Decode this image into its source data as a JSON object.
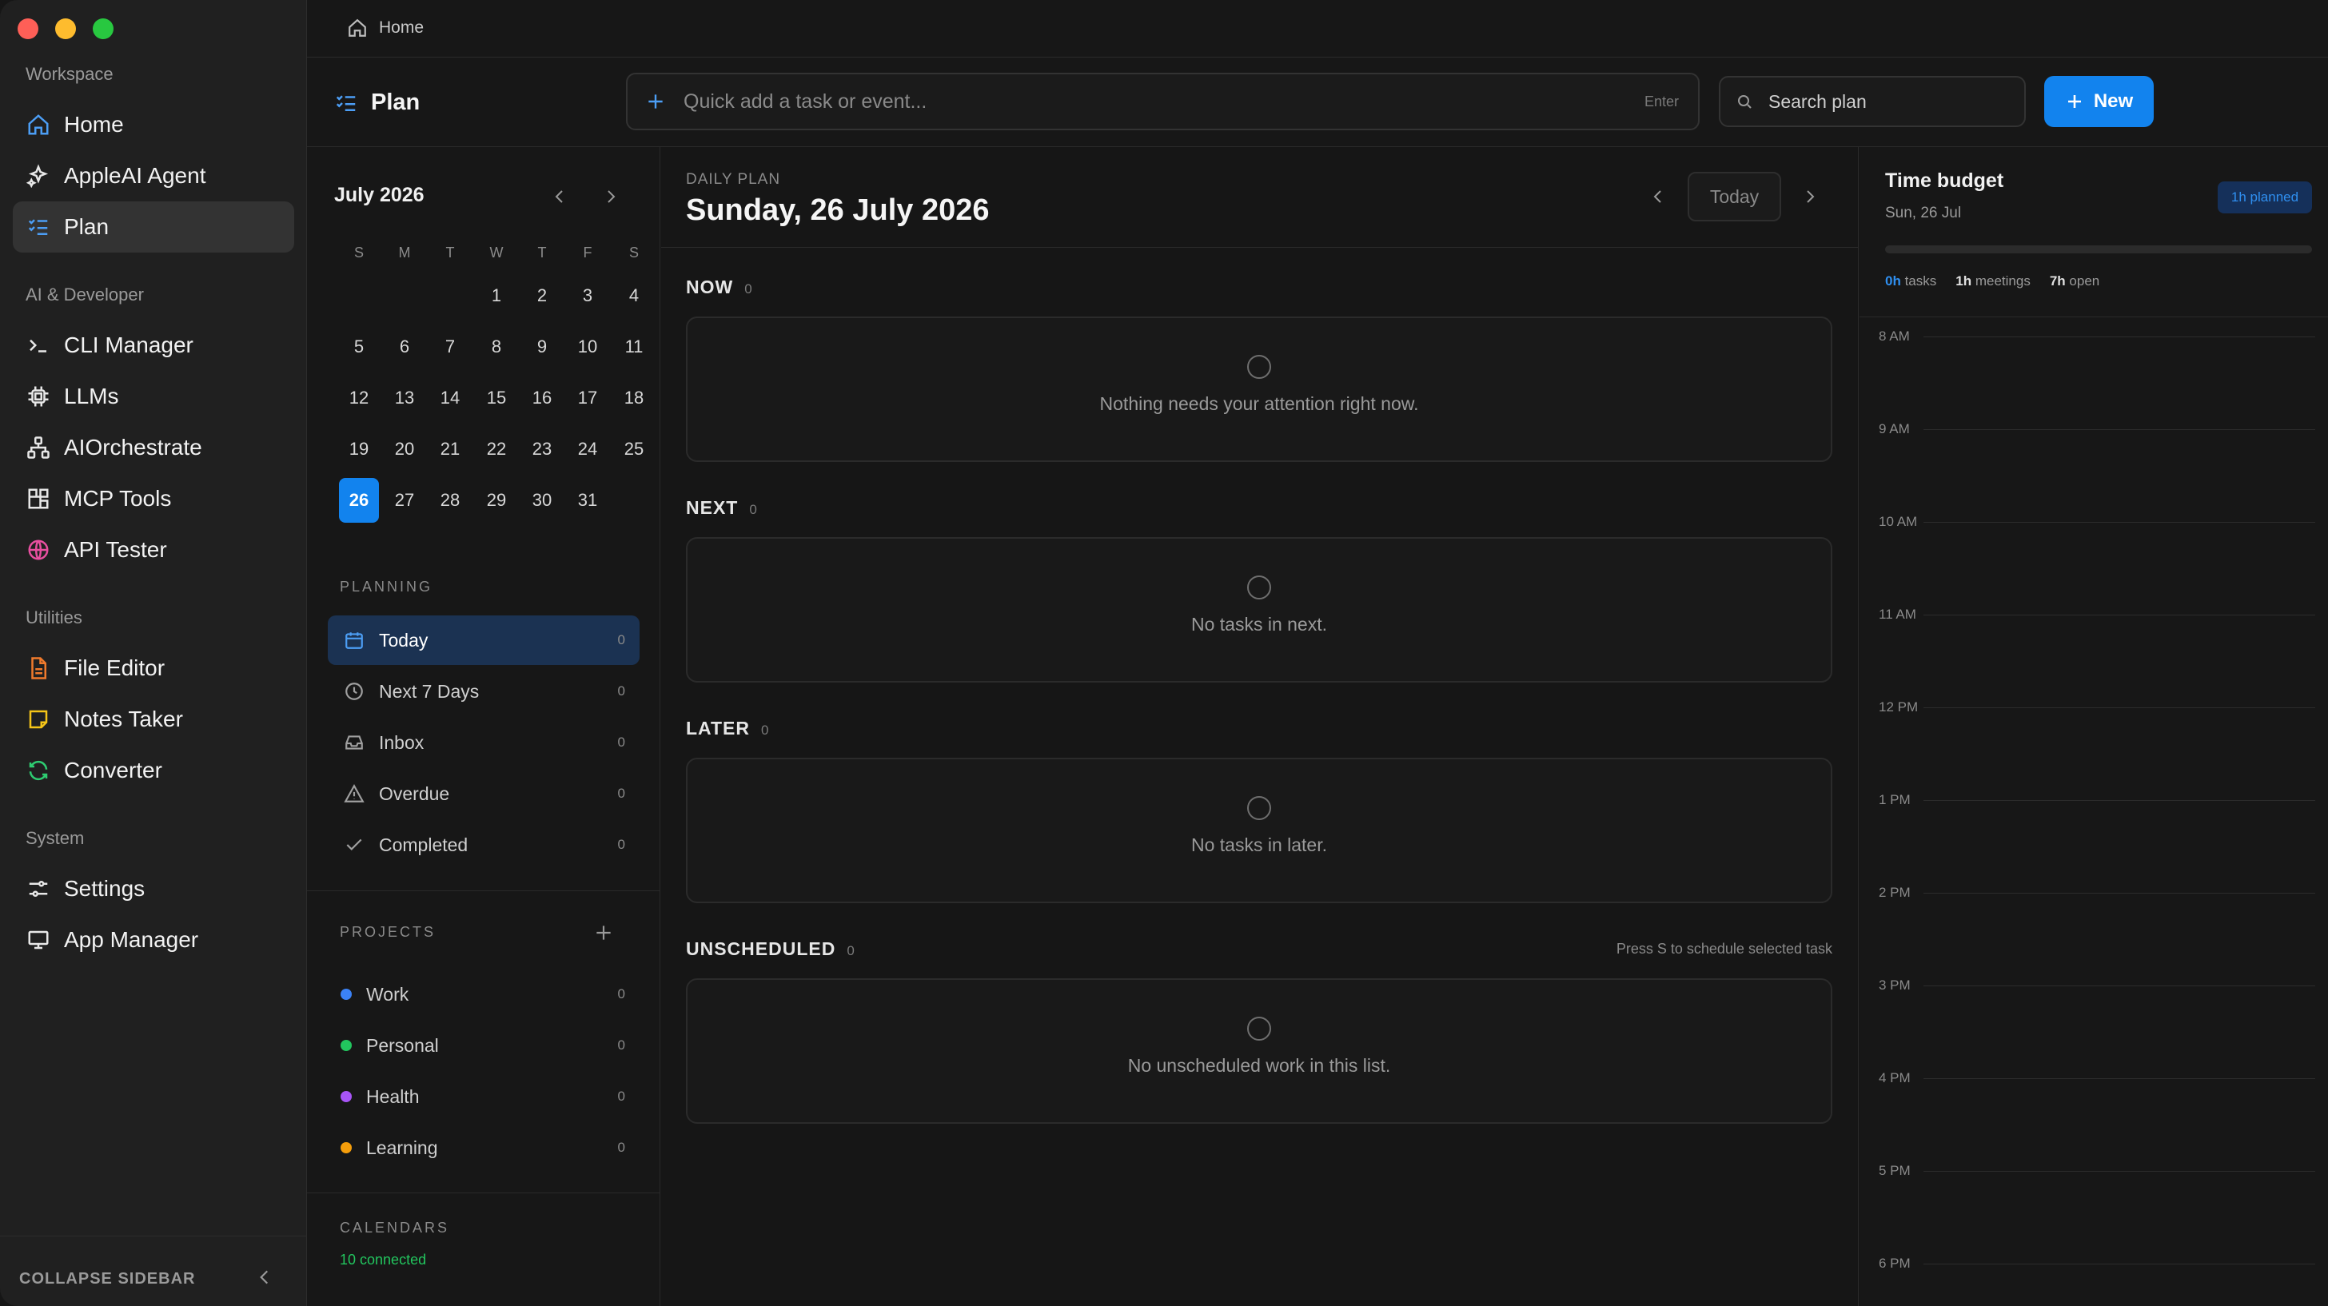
{
  "breadcrumb": {
    "label": "Home"
  },
  "sidebar": {
    "sections": {
      "workspace": "Workspace",
      "ai_dev": "AI & Developer",
      "utilities": "Utilities",
      "system": "System"
    },
    "items": [
      {
        "label": "Home",
        "icon": "home-icon"
      },
      {
        "label": "AppleAI Agent",
        "icon": "sparkles-icon"
      },
      {
        "label": "Plan",
        "icon": "checklist-icon",
        "active": true
      },
      {
        "label": "CLI Manager",
        "icon": "terminal-icon"
      },
      {
        "label": "LLMs",
        "icon": "cpu-icon"
      },
      {
        "label": "AIOrchestrate",
        "icon": "network-icon"
      },
      {
        "label": "MCP Tools",
        "icon": "blocks-icon"
      },
      {
        "label": "API Tester",
        "icon": "globe-icon"
      },
      {
        "label": "File Editor",
        "icon": "file-icon"
      },
      {
        "label": "Notes Taker",
        "icon": "note-icon"
      },
      {
        "label": "Converter",
        "icon": "refresh-icon"
      },
      {
        "label": "Settings",
        "icon": "sliders-icon"
      },
      {
        "label": "App Manager",
        "icon": "monitor-icon"
      }
    ],
    "collapse_label": "COLLAPSE SIDEBAR"
  },
  "header": {
    "title": "Plan",
    "quick_add_placeholder": "Quick add a task or event...",
    "quick_add_hint": "Enter",
    "search_placeholder": "Search plan",
    "new_label": "New"
  },
  "calendar": {
    "month": "July 2026",
    "dow": [
      "S",
      "M",
      "T",
      "W",
      "T",
      "F",
      "S"
    ],
    "selected_day": 26
  },
  "planning": {
    "heading": "PLANNING",
    "items": [
      {
        "label": "Today",
        "count": "0",
        "icon": "calendar-icon",
        "active": true
      },
      {
        "label": "Next 7 Days",
        "count": "0",
        "icon": "clock-icon"
      },
      {
        "label": "Inbox",
        "count": "0",
        "icon": "inbox-icon"
      },
      {
        "label": "Overdue",
        "count": "0",
        "icon": "warning-icon"
      },
      {
        "label": "Completed",
        "count": "0",
        "icon": "check-icon"
      }
    ]
  },
  "projects": {
    "heading": "PROJECTS",
    "items": [
      {
        "label": "Work",
        "count": "0",
        "color": "#3b82f6"
      },
      {
        "label": "Personal",
        "count": "0",
        "color": "#22c55e"
      },
      {
        "label": "Health",
        "count": "0",
        "color": "#a855f7"
      },
      {
        "label": "Learning",
        "count": "0",
        "color": "#f59e0b"
      }
    ]
  },
  "calendars": {
    "heading": "CALENDARS",
    "status": "10 connected"
  },
  "daily": {
    "kicker": "DAILY PLAN",
    "date": "Sunday, 26 July 2026",
    "today_label": "Today",
    "sections": [
      {
        "label": "NOW",
        "count": "0",
        "empty": "Nothing needs your attention right now."
      },
      {
        "label": "NEXT",
        "count": "0",
        "empty": "No tasks in next."
      },
      {
        "label": "LATER",
        "count": "0",
        "empty": "No tasks in later."
      },
      {
        "label": "UNSCHEDULED",
        "count": "0",
        "empty": "No unscheduled work in this list.",
        "hint": "Press S to schedule selected task"
      }
    ]
  },
  "budget": {
    "title": "Time budget",
    "date": "Sun, 26 Jul",
    "badge": "1h planned",
    "stats": [
      {
        "value": "0h",
        "label": "tasks",
        "accent": true
      },
      {
        "value": "1h",
        "label": "meetings"
      },
      {
        "value": "7h",
        "label": "open"
      }
    ],
    "hours": [
      "8 AM",
      "9 AM",
      "10 AM",
      "11 AM",
      "12 PM",
      "1 PM",
      "2 PM",
      "3 PM",
      "4 PM",
      "5 PM",
      "6 PM"
    ]
  },
  "colors": {
    "accent": "#1283ee",
    "active_plan_bg": "#1b3252",
    "calendars_status": "#22c55e"
  }
}
